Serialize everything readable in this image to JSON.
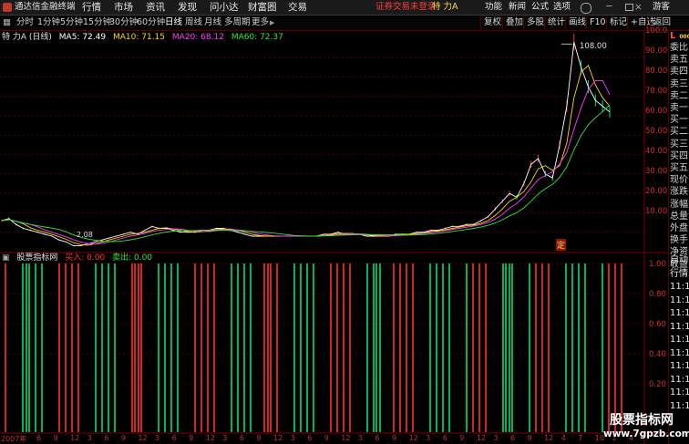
{
  "menu": {
    "app_name": "通达信金融终端",
    "items": [
      "行情",
      "市场",
      "资讯",
      "发现",
      "问小达",
      "财富圈",
      "交易"
    ],
    "login_status": "证券交易未登录",
    "stock_name": "特 力A",
    "right_items": [
      "功能",
      "新闻",
      "公式",
      "选项"
    ],
    "guest": "游客"
  },
  "toolbar": {
    "periods": [
      "分时",
      "1分钟",
      "5分钟",
      "15分钟",
      "30分钟",
      "60分钟",
      "日线",
      "周线",
      "月线",
      "多周期",
      "更多"
    ],
    "active_period": "日线",
    "right_buttons": [
      "复权",
      "叠加",
      "多股",
      "统计",
      "画线",
      "F10",
      "标记",
      "+自选",
      "返回"
    ]
  },
  "price_legend": {
    "name": "特 力A (日线)",
    "ma5": "MA5: 72.49",
    "ma10": "MA10: 71.15",
    "ma20": "MA20: 68.12",
    "ma60": "MA60: 72.37"
  },
  "indicator_legend": {
    "name": "股票指标网",
    "buy": "买入: 0.00",
    "sell": "卖出: 0.00"
  },
  "price_axis": {
    "ticks": [
      "100.0",
      "90.00",
      "80.00",
      "70.00",
      "60.00",
      "50.00",
      "40.00",
      "30.00",
      "20.00",
      "10.00"
    ],
    "max_label": "108.00",
    "min_label": "2.08"
  },
  "indicator_axis": {
    "ticks": [
      "1.00",
      "0.80",
      "0.60",
      "0.40",
      "0.20"
    ]
  },
  "x_axis": {
    "year_label": "2007年",
    "ticks": [
      "6",
      "9",
      "12",
      "3",
      "6",
      "9",
      "12",
      "3",
      "6",
      "9",
      "12",
      "3",
      "6",
      "9",
      "12",
      "3",
      "6",
      "9",
      "12",
      "3",
      "6",
      "9",
      "12",
      "3",
      "6",
      "9",
      "12",
      "3",
      "6",
      "9",
      "12",
      "4",
      "7",
      "10",
      "1",
      "4"
    ]
  },
  "sidebar": {
    "header_left": "L",
    "header_right_value": "000",
    "items": [
      "委比",
      "卖五",
      "卖四",
      "卖三",
      "卖二",
      "卖一",
      "买一",
      "买二",
      "买三",
      "买四",
      "买五",
      "现价",
      "涨跌",
      "涨幅",
      "总量",
      "外盘",
      "换手",
      "净资",
      "收益"
    ],
    "lower_items": [
      "自动",
      "行情",
      "11:1",
      "11:1",
      "11:1",
      "11:1",
      "11:1",
      "11:1",
      "11:1",
      "11:1",
      "11:1",
      "11:1"
    ]
  },
  "ding_marker": "定",
  "watermark": {
    "line1": "股票指标网",
    "line2": "www.7gpzb.com"
  },
  "colors": {
    "ma5": "#ffffff",
    "ma10": "#ffd700",
    "ma20": "#ff3cff",
    "ma60": "#2ee82e",
    "up": "#ff3030",
    "down": "#00e070",
    "grid": "#5a0000"
  },
  "chart_data": [
    {
      "type": "line",
      "title": "特 力A (日线)",
      "ylim": [
        0,
        110
      ],
      "series": [
        {
          "name": "MA5",
          "values": [
            16,
            17,
            14,
            12,
            11,
            10,
            9,
            8,
            6,
            5,
            3,
            3,
            4,
            5,
            6,
            7,
            8,
            9,
            10,
            9,
            11,
            13,
            12,
            12,
            11,
            10,
            10,
            10,
            11,
            11,
            12,
            12,
            11,
            10,
            9,
            8,
            8,
            8,
            8,
            8,
            8,
            8,
            8,
            8,
            8,
            9,
            9,
            10,
            9,
            9,
            9,
            8,
            8,
            8,
            8,
            9,
            9,
            9,
            10,
            10,
            11,
            11,
            12,
            13,
            13,
            14,
            14,
            16,
            18,
            22,
            26,
            30,
            28,
            35,
            45,
            48,
            40,
            38,
            55,
            75,
            108,
            95,
            85,
            78,
            75,
            72
          ]
        }
      ],
      "annotations": [
        {
          "text": "108.00"
        },
        {
          "text": "2.08"
        },
        {
          "text": "定"
        }
      ]
    },
    {
      "type": "bar",
      "title": "股票指标网",
      "ylim": [
        0,
        1
      ],
      "series": [
        {
          "name": "买入",
          "values": [
            1,
            1,
            1,
            1,
            1,
            1,
            1,
            1,
            1,
            1,
            1,
            1,
            1,
            1,
            1,
            1,
            1,
            1,
            1,
            1,
            1,
            1,
            1,
            1,
            1,
            1,
            1,
            1,
            1,
            1,
            1,
            1,
            1,
            1
          ]
        },
        {
          "name": "卖出",
          "values": [
            1,
            1,
            1,
            1,
            1,
            1,
            1,
            1,
            1,
            1,
            1,
            1,
            1,
            1,
            1,
            1,
            1,
            1,
            1,
            1,
            1,
            1,
            1,
            1,
            1,
            1,
            1,
            1,
            1,
            1,
            1,
            1,
            1,
            1,
            1,
            1,
            1,
            1,
            1,
            1
          ]
        }
      ]
    }
  ]
}
